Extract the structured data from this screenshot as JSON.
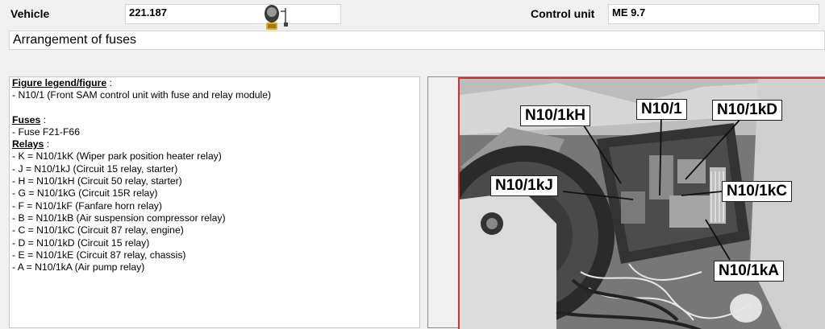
{
  "header": {
    "vehicle_label": "Vehicle",
    "vehicle_value": "221.187",
    "control_unit_label": "Control unit",
    "control_unit_value": "ME 9.7"
  },
  "title": "Arrangement of fuses",
  "legend": {
    "figure_heading": "Figure legend/figure",
    "figure_heading_suffix": " :",
    "figure_item": "- N10/1 (Front SAM control unit with fuse and relay module)",
    "fuses_heading": "Fuses",
    "fuses_heading_suffix": " :",
    "fuses_item": "- Fuse F21-F66",
    "relays_heading": "Relays",
    "relays_heading_suffix": " :",
    "relays": [
      "- K = N10/1kK (Wiper park position heater relay)",
      "- J = N10/1kJ (Circuit 15 relay, starter)",
      "- H = N10/1kH (Circuit 50 relay, starter)",
      "- G = N10/1kG (Circuit 15R relay)",
      "- F = N10/1kF (Fanfare horn relay)",
      "- B = N10/1kB (Air suspension compressor relay)",
      "- C = N10/1kC (Circuit 87 relay, engine)",
      "- D = N10/1kD (Circuit 15 relay)",
      "- E = N10/1kE (Circuit 87 relay, chassis)",
      "- A = N10/1kA (Air pump relay)"
    ]
  },
  "figure": {
    "callouts": {
      "kH": "N10/1kH",
      "n101": "N10/1",
      "kD": "N10/1kD",
      "kJ": "N10/1kJ",
      "kC": "N10/1kC",
      "kA": "N10/1kA"
    }
  }
}
